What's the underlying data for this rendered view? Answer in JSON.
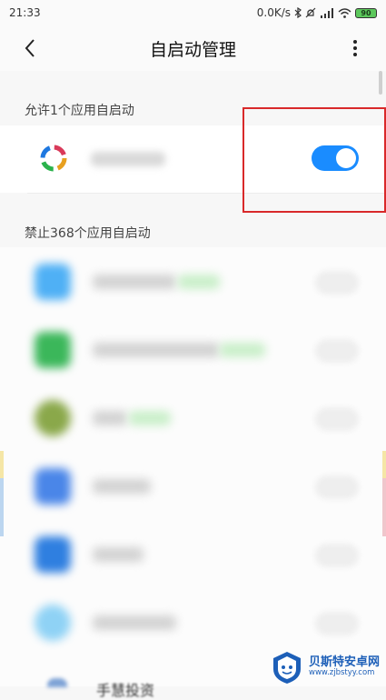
{
  "status_bar": {
    "time": "21:33",
    "net_speed": "0.0K/s",
    "battery_level": "90"
  },
  "header": {
    "title": "自启动管理"
  },
  "allowed_section": {
    "label": "允许1个应用自启动",
    "app": {
      "enabled": true,
      "toggle_color": "#1a8cff"
    }
  },
  "blocked_section": {
    "label": "禁止368个应用自启动",
    "rows": [
      {
        "icon_color": "#4fb0f5",
        "enabled": false
      },
      {
        "icon_color": "#3bb75a",
        "enabled": false
      },
      {
        "icon_color": "#8aa84a",
        "enabled": false
      },
      {
        "icon_color": "#4a86e8",
        "enabled": false
      },
      {
        "icon_color": "#2f7fe0",
        "enabled": false
      },
      {
        "icon_color": "#8fd2f5",
        "enabled": false
      }
    ],
    "last_row_label": "手慧投资"
  },
  "watermark": {
    "title": "贝斯特安卓网",
    "url": "www.zjbstyy.com"
  },
  "colors": {
    "highlight": "#d9292a",
    "accent": "#1a8cff"
  }
}
